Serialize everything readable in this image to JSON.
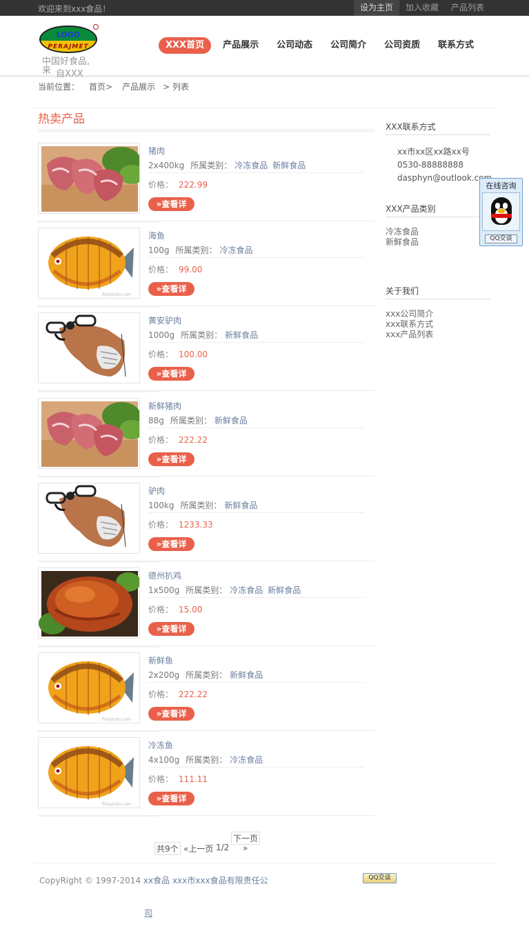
{
  "topbar": {
    "welcome": "欢迎来到xxx食品！",
    "links": [
      "设为主页",
      "加入收藏",
      "产品列表"
    ]
  },
  "header": {
    "logo_text": "LOGO",
    "logo_sub": "PERAJMET",
    "slogan_line1": "中国好食品,来",
    "slogan_line2": "自XXX"
  },
  "nav": [
    "XXX首页",
    "产品展示",
    "公司动态",
    "公司简介",
    "公司资质",
    "联系方式"
  ],
  "breadcrumb": {
    "label": "当前位置：",
    "items": [
      "首页>",
      "产品展示",
      "> 列表"
    ]
  },
  "section_title": "热卖产品",
  "labels": {
    "category": "所属类别：",
    "price": "价格：",
    "detail_button": "»查看详"
  },
  "products": [
    {
      "name": "猪肉",
      "spec": "2x400kg",
      "categories": [
        "冷冻食品",
        "新鲜食品"
      ],
      "price": "222.99",
      "image": "pork"
    },
    {
      "name": "海鱼",
      "spec": "100g",
      "categories": [
        "冷冻食品"
      ],
      "price": "99.00",
      "image": "fish"
    },
    {
      "name": "黄安驴肉",
      "spec": "1000g",
      "categories": [
        "新鲜食品"
      ],
      "price": "100.00",
      "image": "donkey"
    },
    {
      "name": "新鲜猪肉",
      "spec": "88g",
      "categories": [
        "新鲜食品"
      ],
      "price": "222.22",
      "image": "pork"
    },
    {
      "name": "驴肉",
      "spec": "100kg",
      "categories": [
        "新鲜食品"
      ],
      "price": "1233.33",
      "image": "donkey"
    },
    {
      "name": "德州扒鸡",
      "spec": "1x500g",
      "categories": [
        "冷冻食品",
        "新鲜食品"
      ],
      "price": "15.00",
      "image": "chicken"
    },
    {
      "name": "新鲜鱼",
      "spec": "2x200g",
      "categories": [
        "新鲜食品"
      ],
      "price": "222.22",
      "image": "fish"
    },
    {
      "name": "冷冻鱼",
      "spec": "4x100g",
      "categories": [
        "冷冻食品"
      ],
      "price": "111.11",
      "image": "fish"
    }
  ],
  "pager": {
    "total": "共9个",
    "prev": "«上一页",
    "page": "1/2",
    "next": "下一页",
    "next_arrow": "»"
  },
  "sidebar": {
    "contact_title": "XXX联系方式",
    "contact": [
      "xx市xx区xx路xx号",
      "0530-88888888",
      "dasphyn@outlook.com"
    ],
    "category_title": "XXX产品类别",
    "categories": [
      "冷冻食品",
      "新鲜食品"
    ],
    "about_title": "关于我们",
    "about": [
      "xxx公司简介",
      "xxx联系方式",
      "xxx产品列表"
    ]
  },
  "qq_widget": {
    "title": "在线咨询",
    "button": "QQ交谈"
  },
  "footer": {
    "copyright": "CopyRight © 1997-2014",
    "link1": "xx食品",
    "link2_part1": "xxx市xxx食品有限责任公",
    "link2_part2": "司",
    "badge": "QQ交谈"
  }
}
